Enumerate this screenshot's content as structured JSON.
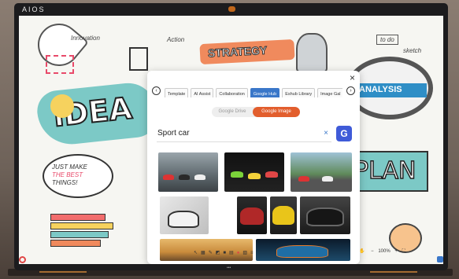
{
  "device": {
    "brand": "AIOS",
    "bottom_logo": "••• "
  },
  "board": {
    "idea_text": "iDEA",
    "plan_text": "PLAN",
    "strategy_text": "STRATEGY",
    "analysis_text": "ANALYSIS",
    "notes": {
      "innovation": "Innovation",
      "action": "Action",
      "todo": "to do",
      "sketch": "sketch",
      "bubble_line1": "JUST MAKE",
      "bubble_line2": "THE BEST",
      "bubble_line3": "THINGS!"
    }
  },
  "dialog": {
    "close": "×",
    "tabs": [
      {
        "label": "Template"
      },
      {
        "label": "AI Assist"
      },
      {
        "label": "Collaboration"
      },
      {
        "label": "Google Hub",
        "active": true
      },
      {
        "label": "Eshub Library"
      },
      {
        "label": "Image Gal"
      }
    ],
    "segment": {
      "left": "Google Drive",
      "right": "Google Image"
    },
    "search": {
      "value": "Sport car",
      "clear": "×",
      "button": "G"
    }
  },
  "toolbar": {
    "zoom": "100%"
  },
  "colors": {
    "accent": "#3a77c9",
    "orange": "#e25e2d",
    "teal": "#7cc9c6"
  }
}
